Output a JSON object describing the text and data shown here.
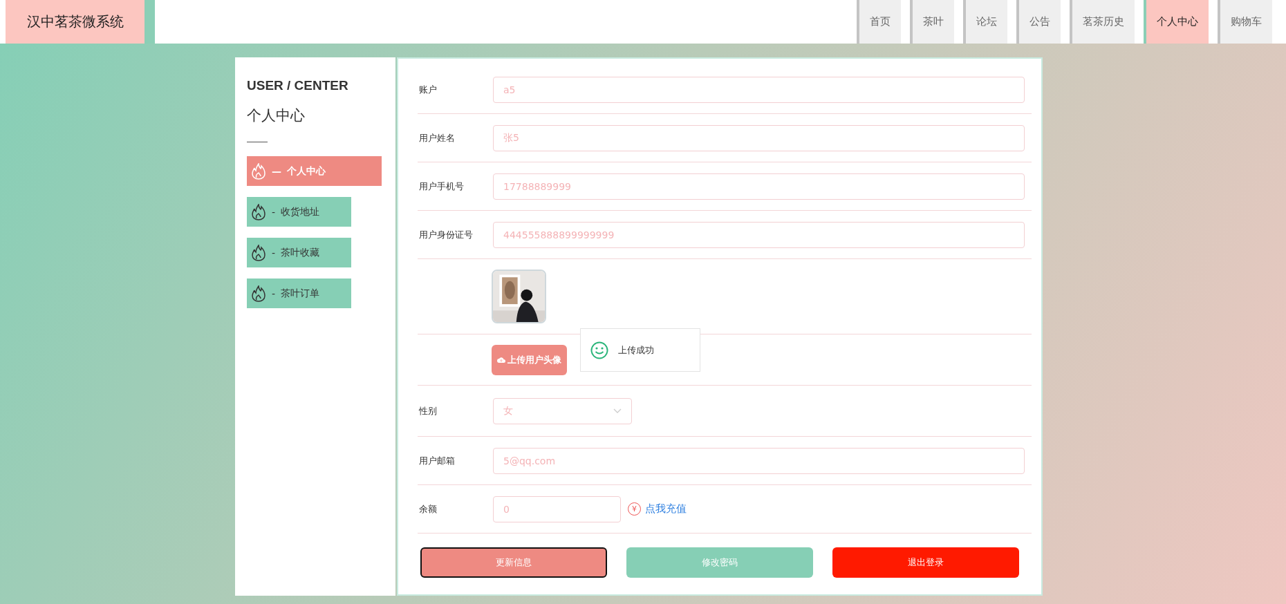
{
  "header": {
    "brand": "汉中茗茶微系统",
    "nav": [
      {
        "label": "首页",
        "selected": false
      },
      {
        "label": "茶叶",
        "selected": false
      },
      {
        "label": "论坛",
        "selected": false
      },
      {
        "label": "公告",
        "selected": false
      },
      {
        "label": "茗茶历史",
        "selected": false
      },
      {
        "label": "个人中心",
        "selected": true
      },
      {
        "label": "购物车",
        "selected": false
      }
    ]
  },
  "sidebar": {
    "title": "USER / CENTER",
    "subtitle": "个人中心",
    "items": [
      {
        "marker": "—",
        "label": "个人中心",
        "selected": true
      },
      {
        "marker": "-",
        "label": "收货地址",
        "selected": false
      },
      {
        "marker": "-",
        "label": "茶叶收藏",
        "selected": false
      },
      {
        "marker": "-",
        "label": "茶叶订单",
        "selected": false
      }
    ]
  },
  "form": {
    "fields": [
      {
        "kind": "text",
        "label": "账户",
        "value": "a5"
      },
      {
        "kind": "text",
        "label": "用户姓名",
        "value": "张5"
      },
      {
        "kind": "text",
        "label": "用户手机号",
        "value": "17788889999"
      },
      {
        "kind": "text",
        "label": "用户身份证号",
        "value": "444555888899999999"
      },
      {
        "kind": "avatar"
      },
      {
        "kind": "upload",
        "button": "上传用户头像"
      },
      {
        "kind": "select",
        "label": "性别",
        "value": "女"
      },
      {
        "kind": "text",
        "label": "用户邮箱",
        "value": "5@qq.com"
      },
      {
        "kind": "balance",
        "label": "余额",
        "value": "0",
        "currency": "¥",
        "link": "点我充值"
      }
    ],
    "buttons": [
      {
        "kind": "update",
        "label": "更新信息"
      },
      {
        "kind": "password",
        "label": "修改密码"
      },
      {
        "kind": "logout",
        "label": "退出登录"
      }
    ]
  },
  "toast": {
    "message": "上传成功"
  }
}
